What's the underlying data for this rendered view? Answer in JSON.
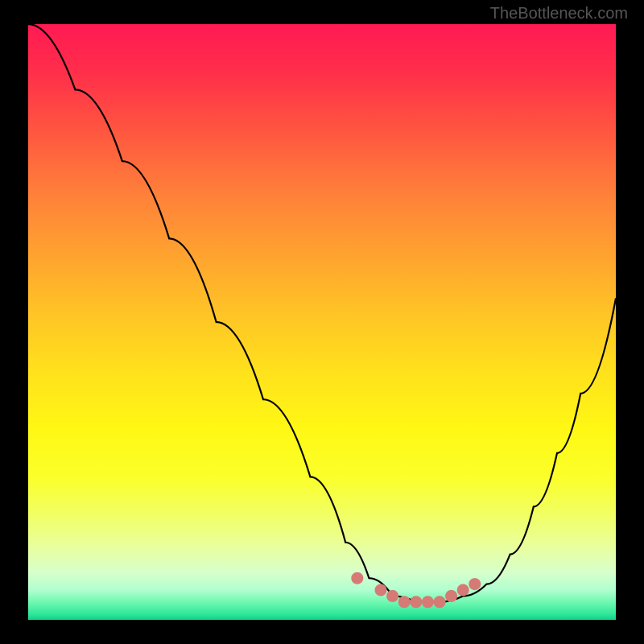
{
  "watermark": "TheBottleneck.com",
  "chart_data": {
    "type": "line",
    "title": "",
    "xlabel": "",
    "ylabel": "",
    "xlim": [
      0,
      100
    ],
    "ylim": [
      0,
      100
    ],
    "grid": false,
    "legend": false,
    "background": "rainbow-heatmap-gradient",
    "series": [
      {
        "name": "bottleneck-curve",
        "x": [
          0,
          8,
          16,
          24,
          32,
          40,
          48,
          54,
          58,
          62,
          66,
          70,
          74,
          78,
          82,
          86,
          90,
          94,
          100
        ],
        "values": [
          100,
          89,
          77,
          64,
          50,
          37,
          24,
          13,
          7,
          4,
          3,
          3,
          4,
          6,
          11,
          19,
          28,
          38,
          54
        ],
        "color": "#000000"
      }
    ],
    "optimal_zone": {
      "name": "optimal-marker-dots",
      "x": [
        56,
        60,
        62,
        64,
        66,
        68,
        70,
        72,
        74,
        76
      ],
      "values": [
        7,
        5,
        4,
        3,
        3,
        3,
        3,
        4,
        5,
        6
      ],
      "color": "#d67a75"
    }
  }
}
